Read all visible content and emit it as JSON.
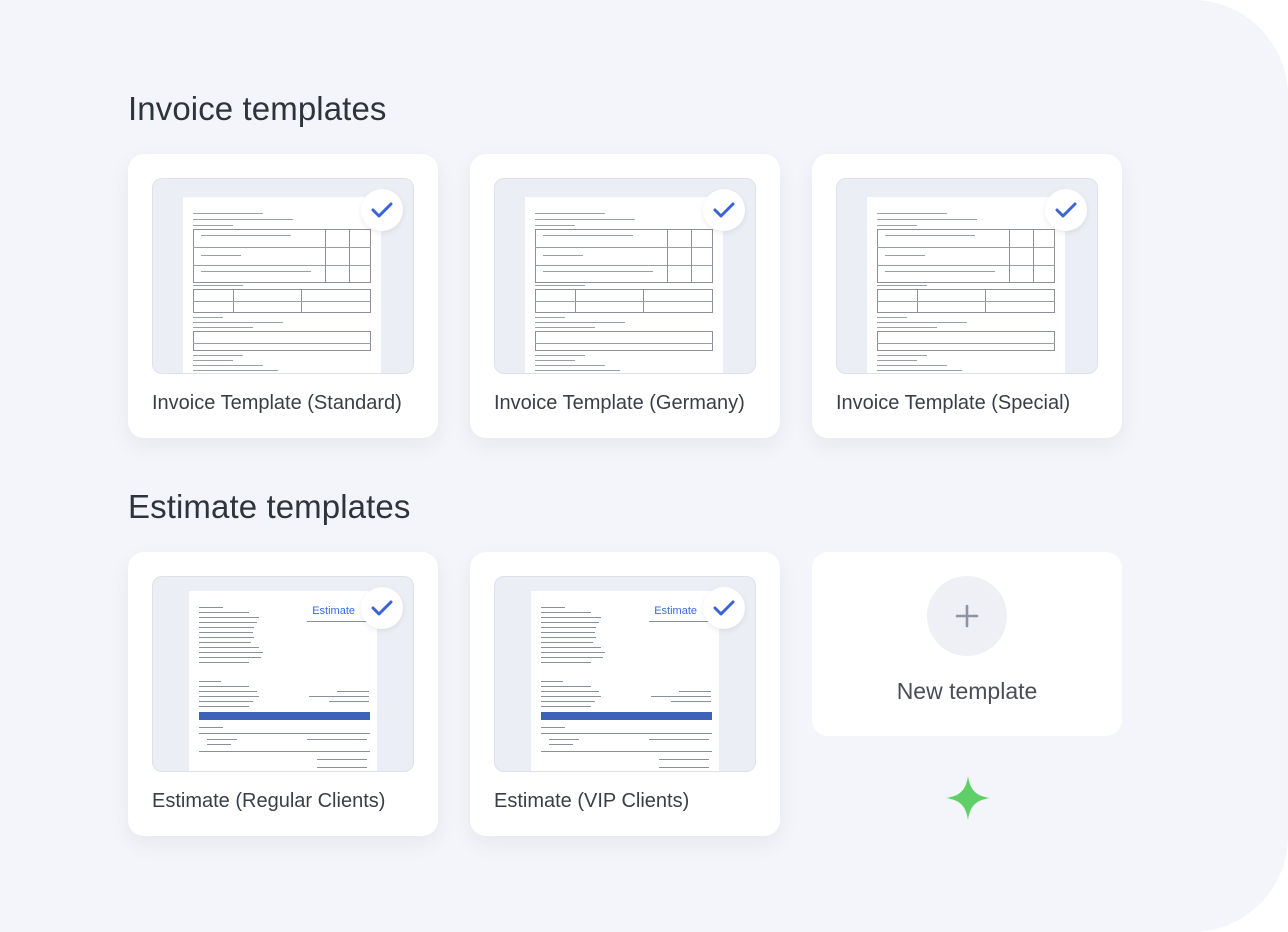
{
  "sections": {
    "invoice": {
      "title": "Invoice templates",
      "cards": [
        {
          "label": "Invoice Template (Standard)",
          "selected": true
        },
        {
          "label": "Invoice Template (Germany)",
          "selected": true
        },
        {
          "label": "Invoice Template (Special)",
          "selected": true
        }
      ]
    },
    "estimate": {
      "title": "Estimate templates",
      "cards": [
        {
          "label": "Estimate (Regular Clients)",
          "selected": true,
          "doc_heading": "Estimate"
        },
        {
          "label": "Estimate (VIP Clients)",
          "selected": true,
          "doc_heading": "Estimate"
        }
      ],
      "new_template": {
        "label": "New template",
        "icon": "plus-icon"
      }
    }
  },
  "colors": {
    "background": "#f3f5fa",
    "check_accent": "#3a63d8",
    "estimate_accent": "#3e62b8",
    "sparkle": "#5fd068"
  },
  "icons": [
    "check-icon",
    "plus-icon",
    "sparkle-icon"
  ]
}
